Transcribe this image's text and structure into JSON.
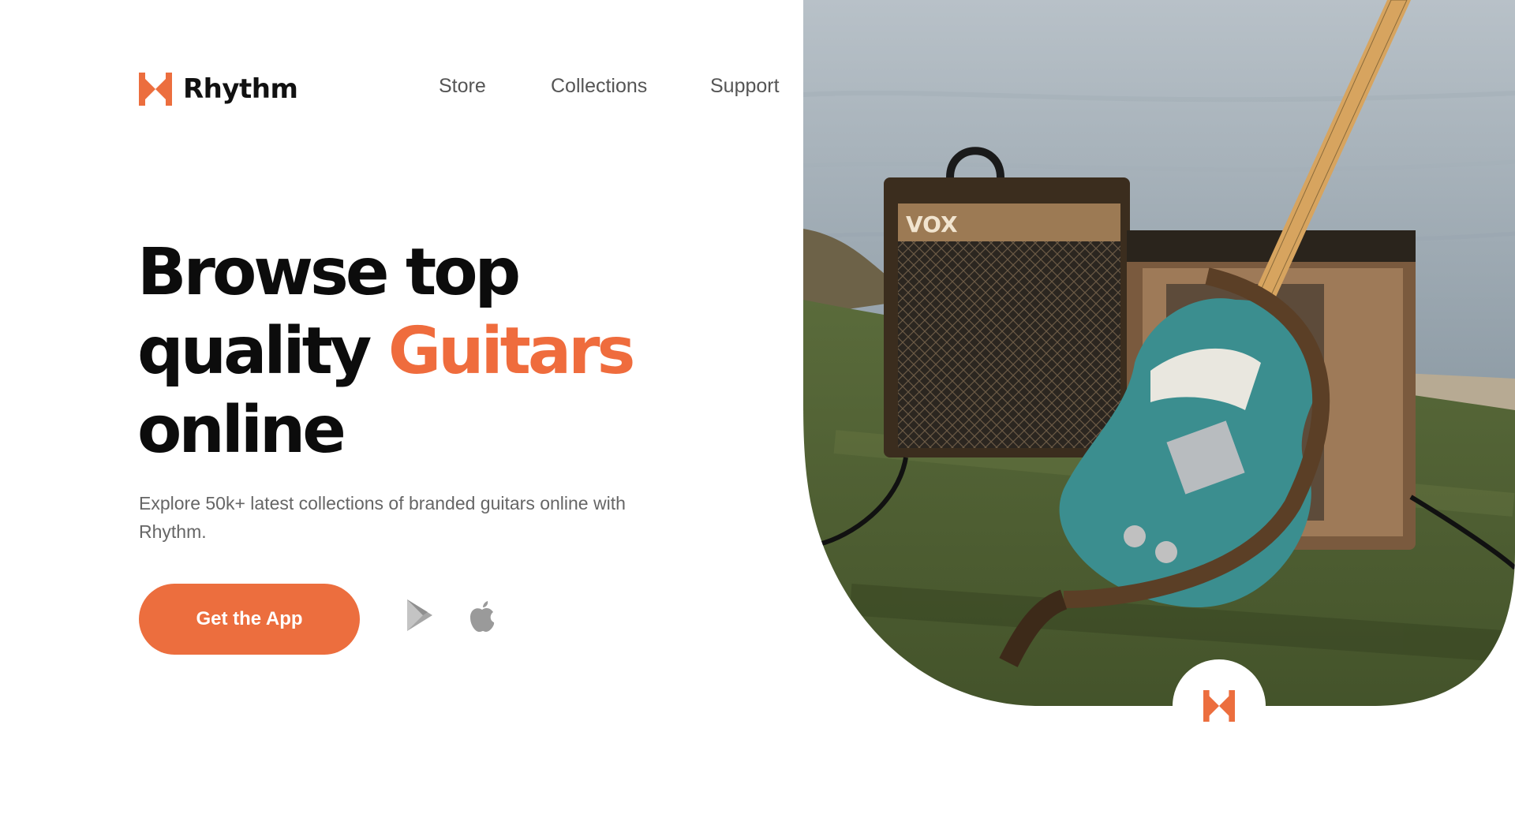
{
  "brand": {
    "name": "Rhythm",
    "accent_color": "#EC6E3E"
  },
  "nav": {
    "items": [
      {
        "label": "Store"
      },
      {
        "label": "Collections"
      },
      {
        "label": "Support"
      }
    ]
  },
  "hero": {
    "headline": {
      "line1": "Browse top",
      "line2_plain": "quality ",
      "line2_accent": "Guitars",
      "line3": "online"
    },
    "subtitle": "Explore 50k+ latest collections of branded guitars online with Rhythm.",
    "cta_label": "Get the App",
    "store_icons": [
      "google-play-icon",
      "apple-icon"
    ],
    "image": "photo of a teal electric guitar leaning on two vintage amplifiers on grass by the sea"
  }
}
